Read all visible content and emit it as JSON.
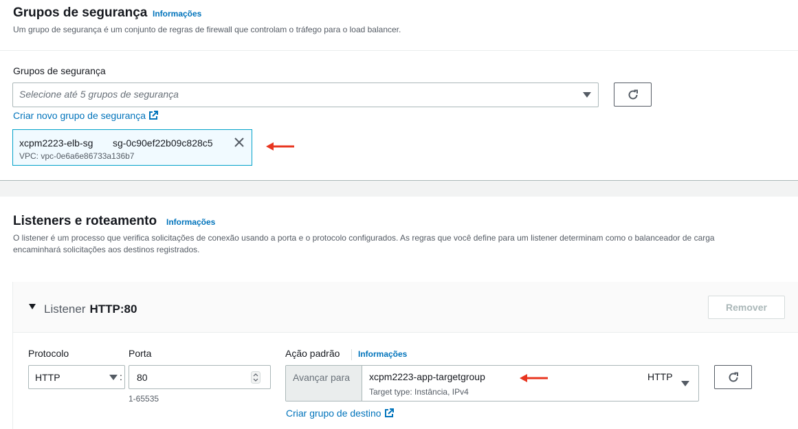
{
  "security_groups": {
    "title": "Grupos de segurança",
    "info_link": "Informações",
    "description": "Um grupo de segurança é um conjunto de regras de firewall que controlam o tráfego para o load balancer.",
    "field_label": "Grupos de segurança",
    "placeholder": "Selecione até 5 grupos de segurança",
    "create_link": "Criar novo grupo de segurança",
    "selected": {
      "name": "xcpm2223-elb-sg",
      "id": "sg-0c90ef22b09c828c5",
      "vpc": "VPC: vpc-0e6a6e86733a136b7"
    }
  },
  "listeners": {
    "title": "Listeners e roteamento",
    "info_link": "Informações",
    "description_line1": "O listener é um processo que verifica solicitações de conexão usando a porta e o protocolo configurados. As regras que você define para um listener determinam como o balanceador de carga",
    "description_line2": "encaminhará solicitações aos destinos registrados.",
    "listener": {
      "label": "Listener",
      "name": "HTTP:80",
      "remove_button": "Remover",
      "protocol_label": "Protocolo",
      "protocol_value": "HTTP",
      "port_label": "Porta",
      "port_value": "80",
      "port_hint": "1-65535",
      "separator": ":",
      "default_action_label": "Ação padrão",
      "default_action_info": "Informações",
      "forward_prefix": "Avançar para",
      "target_group_name": "xcpm2223-app-targetgroup",
      "target_group_protocol": "HTTP",
      "target_type": "Target type: Instância, IPv4",
      "create_target_group_link": "Criar grupo de destino"
    }
  },
  "colors": {
    "link": "#0073bb",
    "annotation_arrow": "#e8351f",
    "token_border": "#00a1c9"
  },
  "icons": [
    "refresh-icon",
    "external-link-icon",
    "close-icon",
    "caret-down-icon",
    "annotation-arrow-icon",
    "stepper-icon"
  ]
}
